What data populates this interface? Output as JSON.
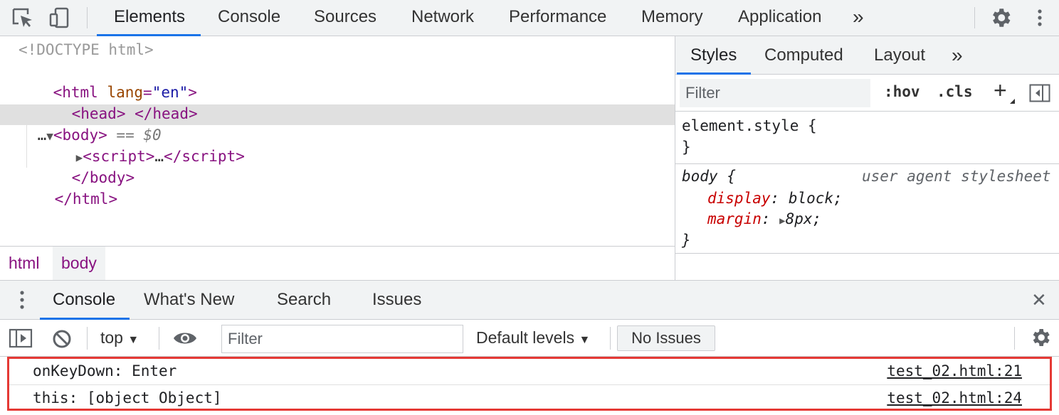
{
  "colors": {
    "accent": "#1a73e8",
    "tag": "#881280",
    "attr_name": "#994500",
    "attr_value": "#1a1aa6",
    "css_property": "#c80000",
    "highlight": "#e53935"
  },
  "topbar": {
    "tabs": [
      {
        "label": "Elements",
        "active": true
      },
      {
        "label": "Console"
      },
      {
        "label": "Sources"
      },
      {
        "label": "Network"
      },
      {
        "label": "Performance"
      },
      {
        "label": "Memory"
      },
      {
        "label": "Application"
      }
    ],
    "more_tabs_glyph": "»",
    "icons": [
      "inspect-element-icon",
      "device-toolbar-icon",
      "chevrons-right-icon",
      "gear-icon",
      "kebab-menu-icon"
    ]
  },
  "dom_tree": {
    "doctype": "<!DOCTYPE html>",
    "html_open": {
      "tag": "html",
      "attr_name": "lang",
      "attr_value": "\"en\""
    },
    "head": {
      "open": "head",
      "close": "head"
    },
    "body_open": {
      "dots": "…",
      "tag": "body",
      "marker": "==",
      "ref": "$0"
    },
    "script": {
      "tag": "script",
      "ellipsis": "…"
    },
    "body_close": "body",
    "html_close": "html"
  },
  "breadcrumb": [
    "html",
    "body"
  ],
  "styles": {
    "tabs": [
      "Styles",
      "Computed",
      "Layout"
    ],
    "more_glyph": "»",
    "filter_placeholder": "Filter",
    "hov": ":hov",
    "cls": ".cls",
    "plus": "+",
    "element_style": {
      "selector": "element.style",
      "open": "{",
      "close": "}"
    },
    "body_rule": {
      "selector": "body",
      "open": "{",
      "source": "user agent stylesheet",
      "props": [
        {
          "name": "display",
          "value": "block"
        },
        {
          "name": "margin",
          "value": "8px"
        }
      ],
      "close": "}"
    }
  },
  "drawer": {
    "tabs": [
      {
        "label": "Console",
        "active": true
      },
      {
        "label": "What's New"
      },
      {
        "label": "Search"
      },
      {
        "label": "Issues"
      }
    ],
    "close_glyph": "✕"
  },
  "console_toolbar": {
    "context": "top",
    "filter_placeholder": "Filter",
    "levels": "Default levels",
    "issues": "No Issues"
  },
  "console_messages": [
    {
      "text": "onKeyDown: Enter",
      "source": "test_02.html:21"
    },
    {
      "text": "this: [object Object]",
      "source": "test_02.html:24"
    }
  ]
}
